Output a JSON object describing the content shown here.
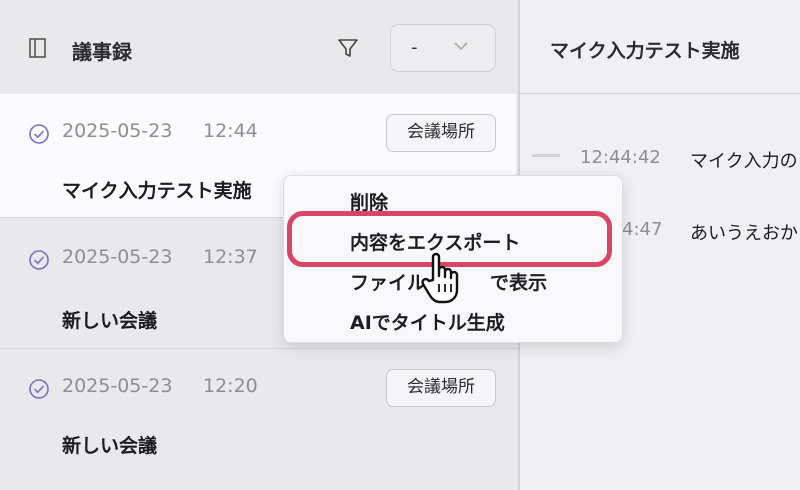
{
  "header": {
    "title": "議事録",
    "dropdown_value": "-",
    "icons": {
      "book": "book-icon",
      "filter": "filter-icon",
      "dropdown": "chevron-down-icon"
    }
  },
  "meetings": [
    {
      "date": "2025-05-23",
      "time": "12:44",
      "title": "マイク入力テスト実施",
      "location_button": "会議場所",
      "status_icon": "check-circle-icon",
      "selected": true
    },
    {
      "date": "2025-05-23",
      "time": "12:37",
      "title": "新しい会議",
      "location_button": "",
      "status_icon": "check-circle-icon",
      "selected": false
    },
    {
      "date": "2025-05-23",
      "time": "12:20",
      "title": "新しい会議",
      "location_button": "会議場所",
      "status_icon": "check-circle-icon",
      "selected": false
    }
  ],
  "detail": {
    "title": "マイク入力テスト実施",
    "transcript": [
      {
        "time": "12:44:42",
        "text": "マイク入力の"
      },
      {
        "time": "4:47",
        "text": "あいうえおかき"
      }
    ]
  },
  "context_menu": {
    "items": [
      "削除",
      "内容をエクスポート",
      "ファイル",
      "で表示",
      "AIでタイトル生成"
    ],
    "highlighted_item": "内容をエクスポート"
  },
  "colors": {
    "highlight": "#d84567",
    "accent_icon": "#7a6fc9"
  }
}
